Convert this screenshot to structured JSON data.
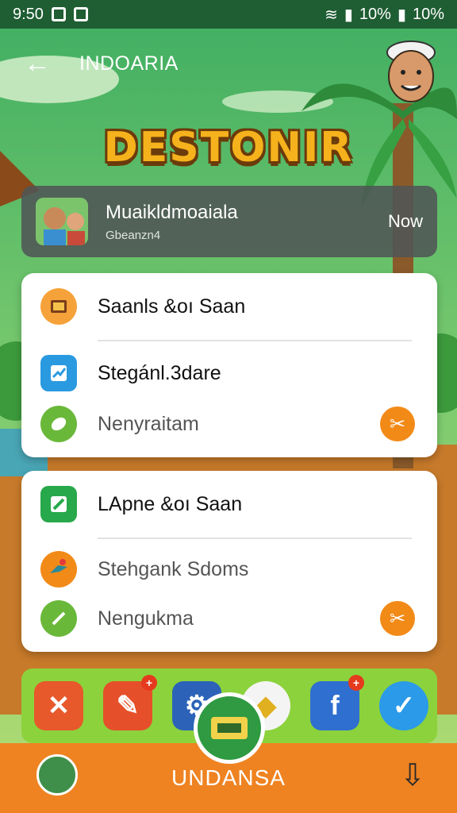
{
  "status_bar": {
    "time": "9:50",
    "battery": "10%",
    "network": "10%"
  },
  "app_bar": {
    "title": "INDOARIA"
  },
  "headline": "DESTONIR",
  "profile": {
    "name": "Muaikldmoaiala",
    "subtitle": "Gbeanzn4",
    "badge": "Now"
  },
  "card1": {
    "items": [
      {
        "label": "Saanls &oı Saan"
      },
      {
        "label": "Stegánl.3dare"
      },
      {
        "label": "Nenyraitam"
      }
    ]
  },
  "card2": {
    "items": [
      {
        "label": "LApne &oı Saan"
      },
      {
        "label": "Stehgank Sdoms"
      },
      {
        "label": "Nengukma"
      }
    ]
  },
  "bottom_bar": {
    "label": "UNDANSA"
  },
  "icons": [
    "back-arrow-icon",
    "avatar",
    "scissors-icon",
    "bird-icon",
    "facebook-icon",
    "check-icon",
    "home-icon",
    "download-icon"
  ],
  "colors": {
    "accent": "#ef8321",
    "dock": "#8cd23c",
    "statusbar": "#1f5d33"
  }
}
